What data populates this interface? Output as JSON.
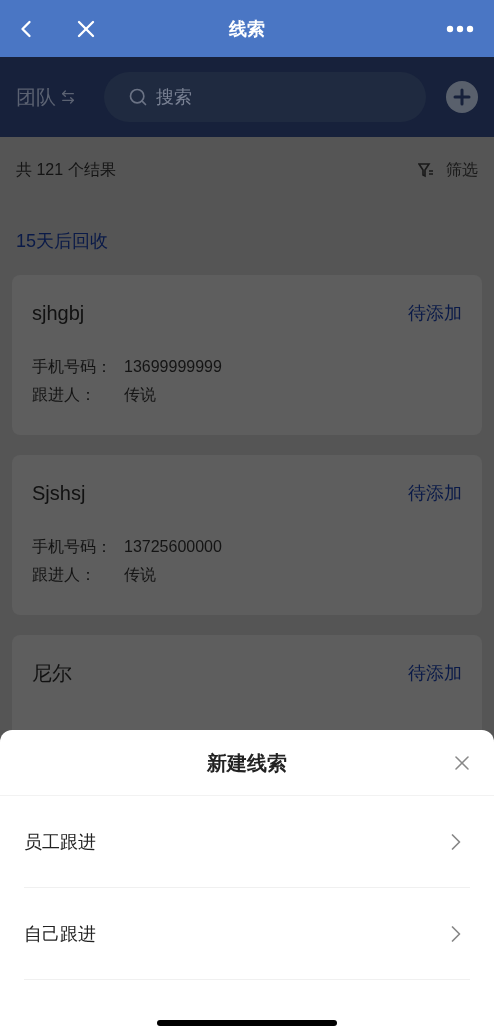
{
  "nav": {
    "title": "线索"
  },
  "header": {
    "scope": "团队",
    "search": {
      "placeholder": "搜索"
    }
  },
  "summary": {
    "count": "共 121 个结果",
    "filter": "筛选"
  },
  "group": {
    "title": "15天后回收"
  },
  "leads": [
    {
      "name": "sjhgbj",
      "status": "待添加",
      "fields": [
        {
          "label": "手机号码：",
          "value": "13699999999"
        },
        {
          "label": "跟进人：",
          "value": "传说"
        }
      ]
    },
    {
      "name": "Sjshsj",
      "status": "待添加",
      "fields": [
        {
          "label": "手机号码：",
          "value": "13725600000"
        },
        {
          "label": "跟进人：",
          "value": "传说"
        }
      ]
    },
    {
      "name": "尼尔",
      "status": "待添加"
    }
  ],
  "sheet": {
    "title": "新建线索",
    "options": [
      "员工跟进",
      "自己跟进"
    ]
  }
}
